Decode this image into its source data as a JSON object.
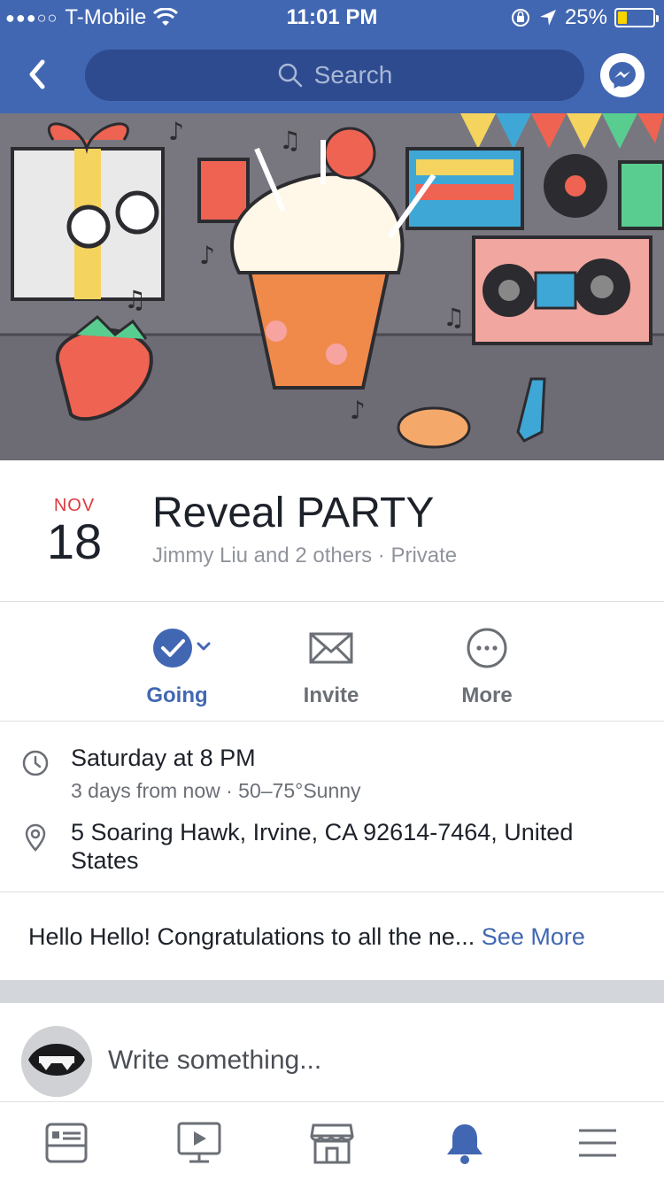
{
  "status_bar": {
    "signal": "●●●○○",
    "carrier": "T-Mobile",
    "time": "11:01 PM",
    "battery": "25%",
    "battery_level": 0.25
  },
  "nav": {
    "search_placeholder": "Search"
  },
  "event": {
    "month": "NOV",
    "day": "18",
    "title": "Reveal PARTY",
    "subtitle": "Jimmy Liu and 2 others · Private"
  },
  "actions": [
    {
      "label": "Going"
    },
    {
      "label": "Invite"
    },
    {
      "label": "More"
    }
  ],
  "details": {
    "time_main": "Saturday at 8 PM",
    "time_sub": "3 days from now · 50–75°Sunny",
    "location": "5 Soaring Hawk, Irvine, CA 92614-7464, United States"
  },
  "description": {
    "text": "Hello Hello! Congratulations to all the ne... ",
    "see_more": "See More"
  },
  "composer": {
    "placeholder": "Write something..."
  },
  "colors": {
    "brand": "#4267b2",
    "date_red": "#e0393e"
  },
  "tabbar": {
    "icons": [
      "news-feed-icon",
      "video-icon",
      "marketplace-icon",
      "notifications-icon",
      "menu-icon"
    ],
    "active": "notifications-icon"
  }
}
